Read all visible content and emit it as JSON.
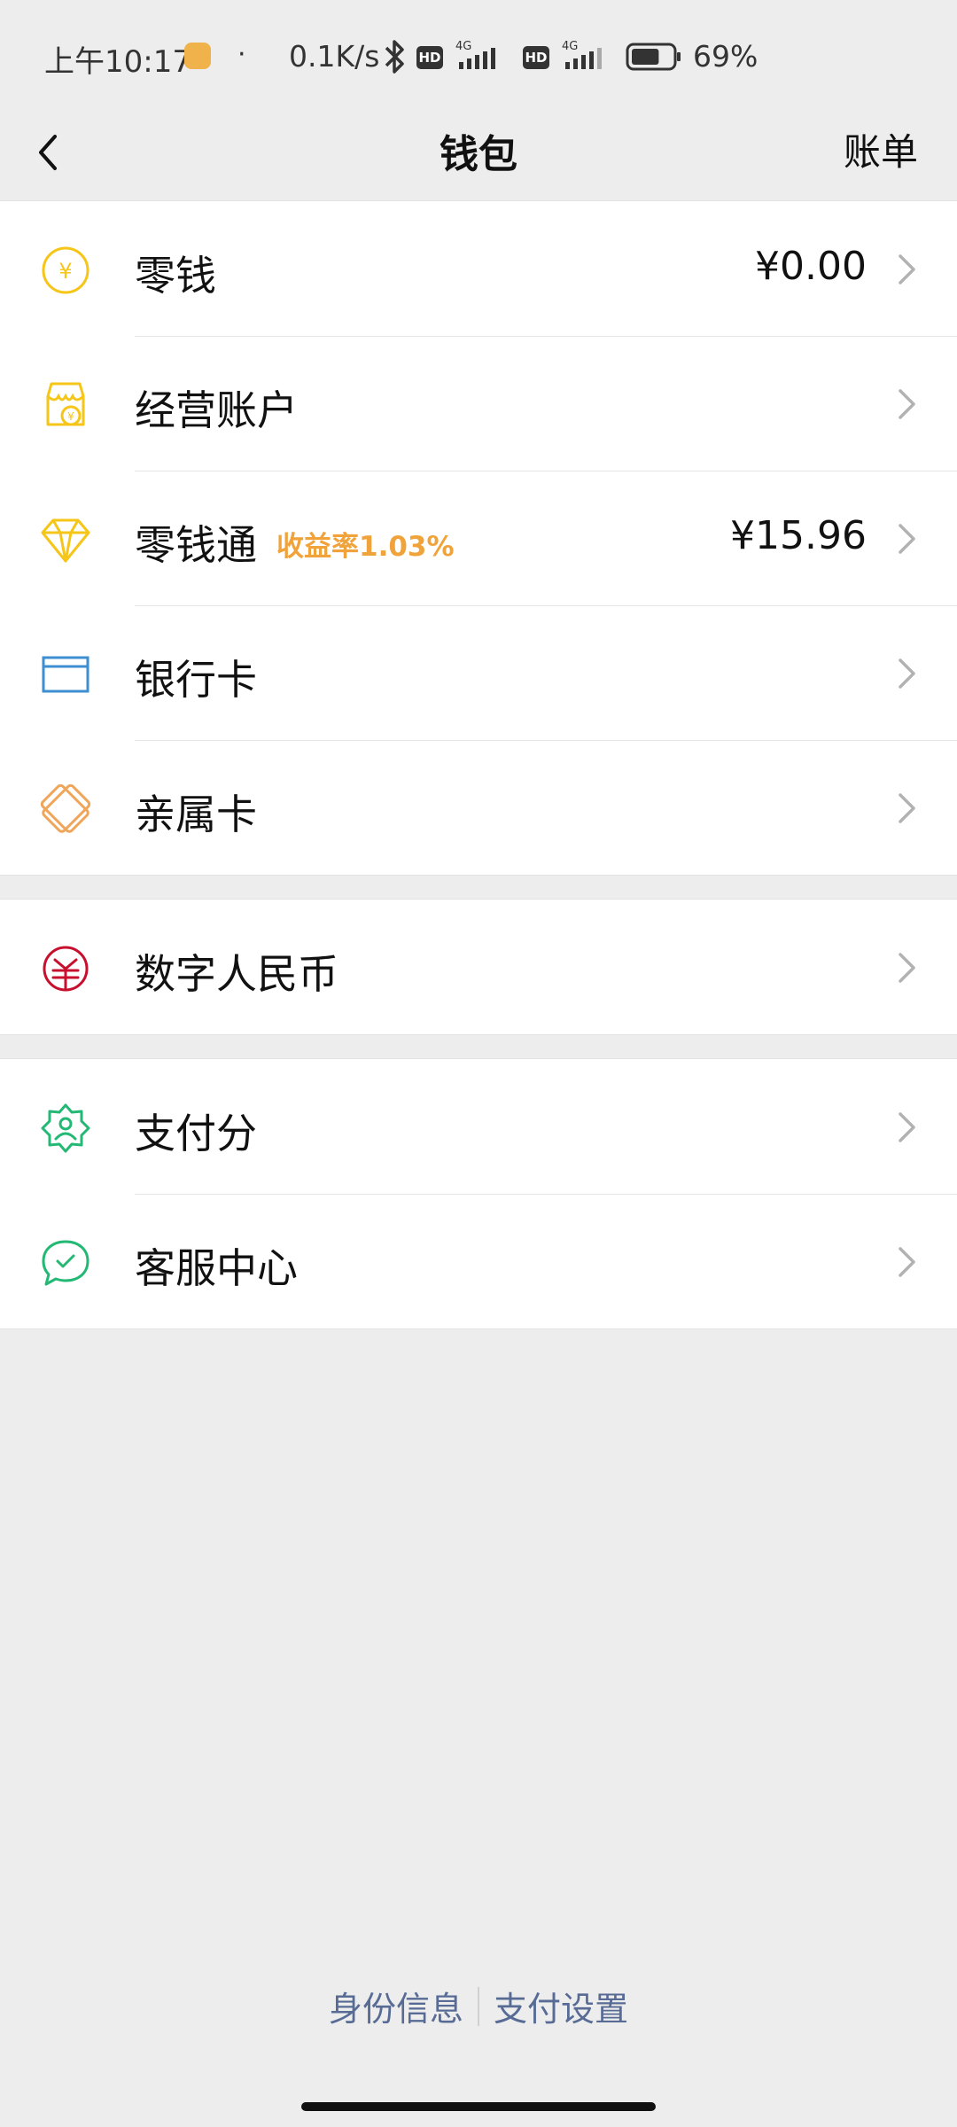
{
  "status_bar": {
    "time": "上午10:17",
    "dot": "·",
    "network_speed": "0.1K/s",
    "hd_label": "HD",
    "network_type": "4G",
    "battery_percent": "69%",
    "battery_level": 0.69
  },
  "nav": {
    "title": "钱包",
    "action_label": "账单"
  },
  "groups": [
    {
      "items": [
        {
          "label": "零钱",
          "value": "¥0.00",
          "icon": "yuan-coin-icon",
          "icon_color": "#f5c518"
        },
        {
          "label": "经营账户",
          "value": "",
          "icon": "shop-icon",
          "icon_color": "#f5c518"
        },
        {
          "label": "零钱通",
          "tag": "收益率1.03%",
          "value": "¥15.96",
          "icon": "diamond-icon",
          "icon_color": "#f5c518"
        },
        {
          "label": "银行卡",
          "value": "",
          "icon": "bank-card-icon",
          "icon_color": "#3d8fd1"
        },
        {
          "label": "亲属卡",
          "value": "",
          "icon": "family-card-icon",
          "icon_color": "#f0a65a"
        }
      ]
    },
    {
      "items": [
        {
          "label": "数字人民币",
          "value": "",
          "icon": "digital-rmb-icon",
          "icon_color": "#c8102e"
        }
      ]
    },
    {
      "items": [
        {
          "label": "支付分",
          "value": "",
          "icon": "pay-score-icon",
          "icon_color": "#23b874"
        },
        {
          "label": "客服中心",
          "value": "",
          "icon": "customer-service-icon",
          "icon_color": "#23b874"
        }
      ]
    }
  ],
  "footer": {
    "identity_label": "身份信息",
    "pay_settings_label": "支付设置",
    "link_color": "#576b95"
  },
  "colors": {
    "background": "#ededed",
    "card": "#ffffff",
    "tag": "#f0a33b"
  }
}
